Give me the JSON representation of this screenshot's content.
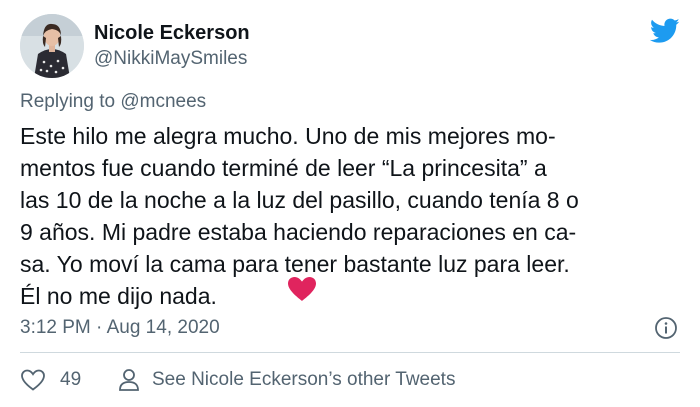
{
  "author": {
    "name": "Nicole Eckerson",
    "handle": "@NikkiMaySmiles"
  },
  "reply": {
    "text": "Replying to @mcnees"
  },
  "tweet": {
    "lines": [
      "Este hilo me alegra mucho. Uno de mis mejores mo-",
      "mentos fue cuando terminé de leer “La princesita” a",
      "las 10 de la noche a la luz del pasillo, cuando tenía 8 o",
      "9 años. Mi padre estaba haciendo reparaciones en ca-",
      "sa. Yo moví la cama para tener bastante luz para leer.",
      "Él no me dijo nada."
    ],
    "emoji": "red-heart-emoji",
    "timestamp": "3:12 PM · Aug 14, 2020"
  },
  "actions": {
    "like_count": "49",
    "profile_link": "See Nicole Eckerson’s other Tweets"
  },
  "icons": {
    "logo": "twitter-bird-icon",
    "info": "info-icon",
    "like": "heart-outline-icon",
    "profile": "person-icon"
  },
  "colors": {
    "twitter_blue": "#1d9bf0",
    "heart_red": "#e0245e",
    "secondary_text": "#536471",
    "primary_text": "#0f1419"
  }
}
